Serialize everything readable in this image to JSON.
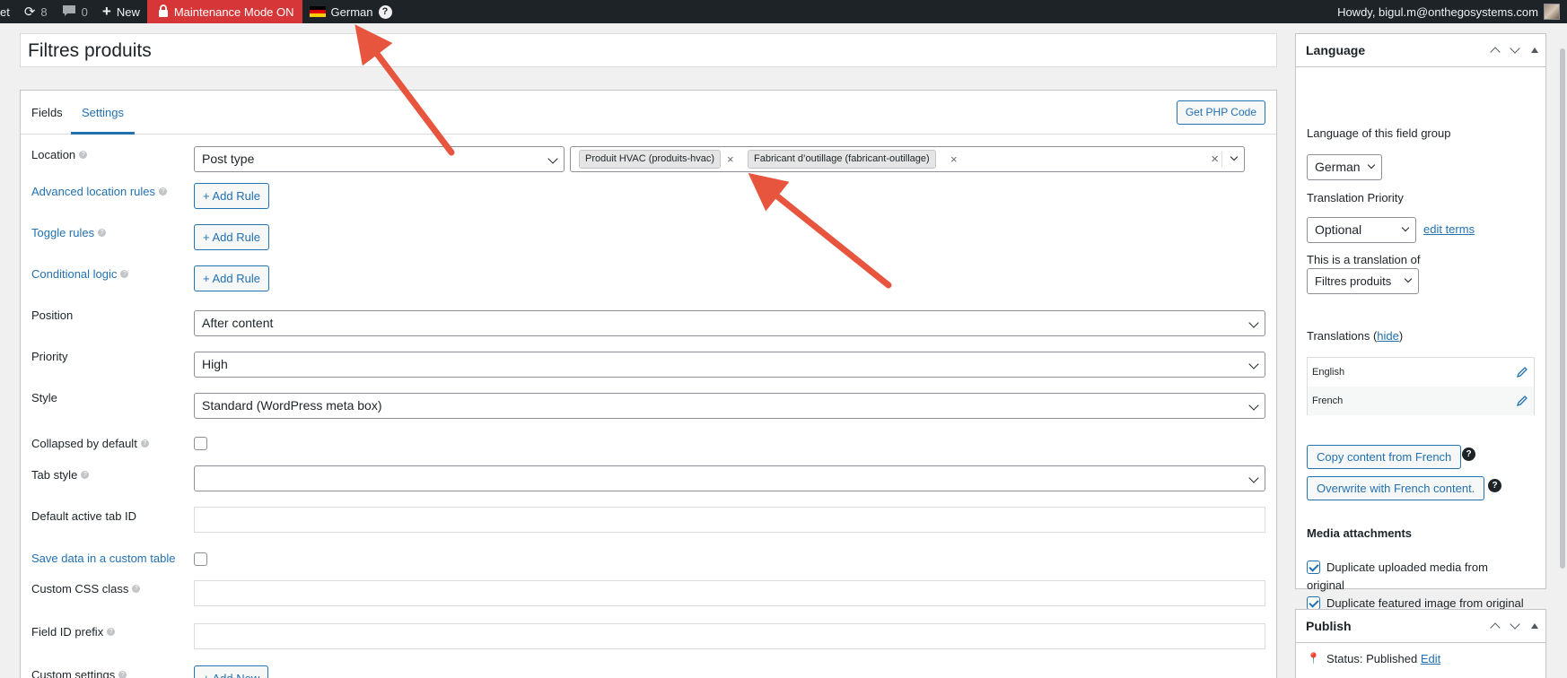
{
  "adminbar": {
    "site_fragment": "et",
    "updates_count": "8",
    "comments_count": "0",
    "new_label": "New",
    "maintenance_label": "Maintenance Mode ON",
    "language_label": "German",
    "help_glyph": "?",
    "howdy": "Howdy, bigul.m@onthegosystems.com"
  },
  "title": "Filtres produits",
  "tabs": [
    "Fields",
    "Settings"
  ],
  "active_tab": "Settings",
  "get_php_label": "Get PHP Code",
  "settings": {
    "location_label": "Location",
    "location_type": "Post type",
    "location_tags": [
      "Produit HVAC (produits-hvac)",
      "Fabricant d’outillage (fabricant-outillage)"
    ],
    "advanced_rules_label": "Advanced location rules",
    "toggle_rules_label": "Toggle rules",
    "conditional_logic_label": "Conditional logic",
    "add_rule_label": "+ Add Rule",
    "position_label": "Position",
    "position_value": "After content",
    "priority_label": "Priority",
    "priority_value": "High",
    "style_label": "Style",
    "style_value": "Standard (WordPress meta box)",
    "collapsed_label": "Collapsed by default",
    "tab_style_label": "Tab style",
    "tab_style_value": "",
    "default_tab_label": "Default active tab ID",
    "custom_table_label": "Save data in a custom table",
    "css_class_label": "Custom CSS class",
    "field_prefix_label": "Field ID prefix",
    "custom_settings_label": "Custom settings",
    "add_new_label": "+ Add New"
  },
  "language_box": {
    "title": "Language",
    "group_lang_label": "Language of this field group",
    "group_lang_value": "German",
    "priority_label": "Translation Priority",
    "priority_value": "Optional",
    "edit_terms": "edit terms",
    "translation_of_label": "This is a translation of",
    "translation_of_value": "Filtres produits",
    "translations_label": "Translations (",
    "hide_link": "hide",
    "translations_close": ")",
    "translations": [
      "English",
      "French"
    ],
    "copy_button": "Copy content from French",
    "overwrite_button": "Overwrite with French content.",
    "media_label": "Media attachments",
    "dup_media_line1": "Duplicate uploaded media from",
    "dup_media_line2": "original",
    "dup_featured": "Duplicate featured image from original"
  },
  "publish_box": {
    "title": "Publish",
    "status_label": "Status: Published",
    "edit_link": "Edit"
  },
  "colors": {
    "accent": "#2271b1",
    "maintenance": "#d63638",
    "adminbar": "#1d2327",
    "arrow": "#e8553e"
  }
}
